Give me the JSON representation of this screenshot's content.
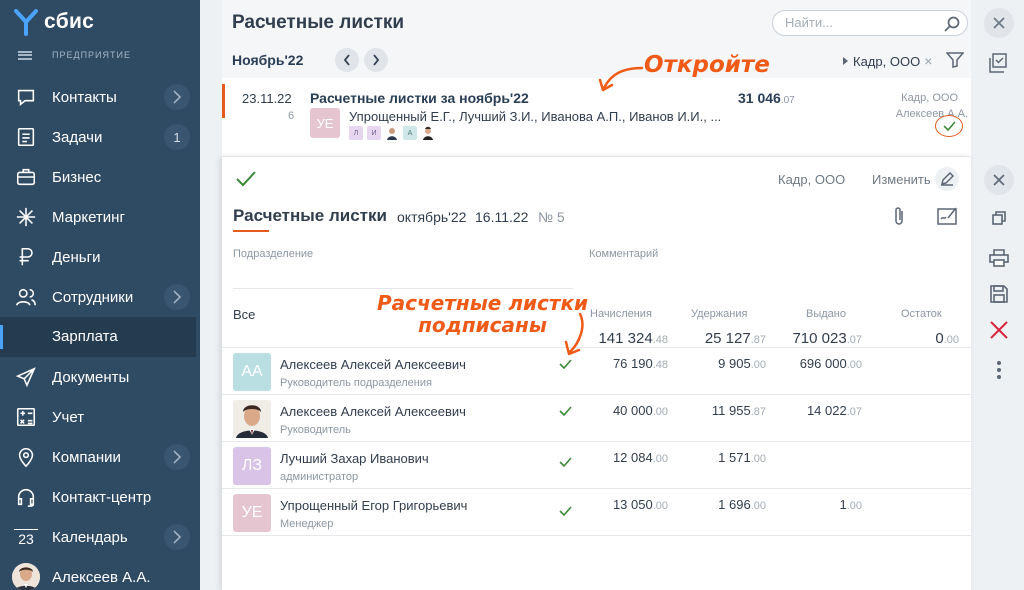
{
  "app": {
    "logo_text": "сбис",
    "company_label": "ПРЕДПРИЯТИЕ"
  },
  "colors": {
    "sidebar": "#2f4a63",
    "accent": "#e55b1e",
    "success": "#3d8a38",
    "link": "#4aa3ff"
  },
  "sidebar": {
    "items": [
      {
        "label": "Контакты",
        "icon": "chat-icon",
        "side": "chevron"
      },
      {
        "label": "Задачи",
        "icon": "tasks-icon",
        "side": "1"
      },
      {
        "label": "Бизнес",
        "icon": "briefcase-icon",
        "side": ""
      },
      {
        "label": "Маркетинг",
        "icon": "sparkle-icon",
        "side": ""
      },
      {
        "label": "Деньги",
        "icon": "ruble-icon",
        "side": ""
      },
      {
        "label": "Сотрудники",
        "icon": "people-icon",
        "side": "chevron"
      },
      {
        "label": "Документы",
        "icon": "paper-plane-icon",
        "side": ""
      },
      {
        "label": "Учет",
        "icon": "calculator-icon",
        "side": ""
      },
      {
        "label": "Компании",
        "icon": "map-pin-icon",
        "side": "chevron"
      },
      {
        "label": "Контакт-центр",
        "icon": "headset-icon",
        "side": ""
      },
      {
        "label": "Календарь",
        "icon": "calendar-icon",
        "side": "chevron"
      }
    ],
    "calendar_day": "23",
    "active_sub": "Зарплата",
    "user_name": "Алексеев А.А."
  },
  "header": {
    "title": "Расчетные листки",
    "search_placeholder": "Найти...",
    "period": "Ноябрь'22",
    "filter_chip": "Кадр, ООО",
    "filter_chip_remove": "×"
  },
  "doc_row": {
    "date": "23.11.22",
    "num": "6",
    "title": "Расчетные листки за ноябрь'22",
    "avatar": "УЕ",
    "people": "Упрощенный Е.Г., Лучший З.И., Иванова А.П., Иванов И.И., ...",
    "minis": [
      "Л",
      "И",
      "",
      "А",
      ""
    ],
    "sum_int": "31 046",
    "sum_dec": ".07",
    "org": "Кадр, ООО",
    "responsible": "Алексеев А.А."
  },
  "annotations": {
    "open": "Откройте",
    "signed_line1": "Расчетные листки",
    "signed_line2": "подписаны"
  },
  "detail": {
    "org": "Кадр, ООО",
    "edit_label": "Изменить",
    "title": "Расчетные листки",
    "period": "октябрь'22",
    "date": "16.11.22",
    "num": "№ 5",
    "headers": {
      "division": "Подразделение",
      "comment": "Комментарий",
      "accrued": "Начисления",
      "withheld": "Удержания",
      "paid": "Выдано",
      "remain": "Остаток"
    },
    "all_label": "Все",
    "totals": {
      "accrued": "141 324",
      "accrued_dec": ".48",
      "withheld": "25 127",
      "withheld_dec": ".87",
      "paid": "710 023",
      "paid_dec": ".07",
      "remain": "0",
      "remain_dec": ".00"
    },
    "employees": [
      {
        "initials": "АА",
        "color": "#b9dfe2",
        "name": "Алексеев Алексей Алексеевич",
        "position": "Руководитель подразделения",
        "accrued": "76 190",
        "accrued_dec": ".48",
        "withheld": "9 905",
        "withheld_dec": ".00",
        "paid": "696 000",
        "paid_dec": ".00",
        "remain": "",
        "remain_dec": ""
      },
      {
        "initials": "",
        "color": "#ffffff",
        "name": "Алексеев Алексей Алексеевич",
        "position": "Руководитель",
        "accrued": "40 000",
        "accrued_dec": ".00",
        "withheld": "11 955",
        "withheld_dec": ".87",
        "paid": "14 022",
        "paid_dec": ".07",
        "remain": "",
        "remain_dec": ""
      },
      {
        "initials": "ЛЗ",
        "color": "#d9c3e6",
        "name": "Лучший Захар Иванович",
        "position": "администратор",
        "accrued": "12 084",
        "accrued_dec": ".00",
        "withheld": "1 571",
        "withheld_dec": ".00",
        "paid": "",
        "paid_dec": "",
        "remain": "",
        "remain_dec": ""
      },
      {
        "initials": "УЕ",
        "color": "#e5c5cf",
        "name": "Упрощенный Егор Григорьевич",
        "position": "Менеджер",
        "accrued": "13 050",
        "accrued_dec": ".00",
        "withheld": "1 696",
        "withheld_dec": ".00",
        "paid": "1",
        "paid_dec": ".00",
        "remain": "",
        "remain_dec": ""
      }
    ]
  }
}
